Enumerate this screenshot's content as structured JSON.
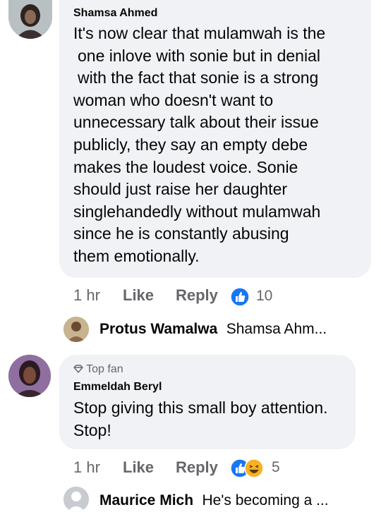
{
  "comments": [
    {
      "author": "Shamsa Ahmed",
      "lines": [
        "It's now clear that mulamwah is the",
        "one inlove with sonie but in denial",
        "with the fact that sonie is a strong",
        "woman who doesn't want to",
        "unnecessary talk about their issue",
        "publicly, they say an empty debe",
        "makes the loudest voice. Sonie",
        "should just raise her daughter",
        "singlehandedly without mulamwah",
        "since he is constantly abusing",
        "them emotionally."
      ],
      "time": "1 hr",
      "like_label": "Like",
      "reply_label": "Reply",
      "reaction_count": "10",
      "reactions": [
        "like-icon"
      ],
      "reply_preview": {
        "author": "Protus Wamalwa",
        "snippet": "Shamsa Ahm..."
      }
    },
    {
      "badge": "Top fan",
      "author": "Emmeldah Beryl",
      "lines": [
        "Stop giving this small boy attention.",
        "Stop!"
      ],
      "time": "1 hr",
      "like_label": "Like",
      "reply_label": "Reply",
      "reaction_count": "5",
      "reactions": [
        "like-icon",
        "haha-icon"
      ],
      "reply_preview": {
        "author": "Maurice Mich",
        "snippet": "He's becoming a ..."
      }
    }
  ],
  "colors": {
    "bubble": "#f0f2f5",
    "secondary_text": "#65676b",
    "like_blue": "#1877f2",
    "haha_yellow": "#f7b125"
  }
}
